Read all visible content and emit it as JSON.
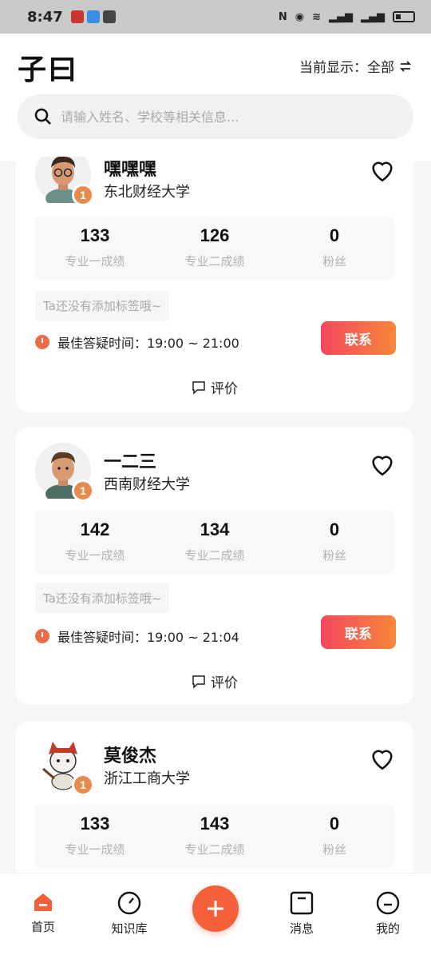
{
  "statusbar": {
    "time": "8:47"
  },
  "header": {
    "title": "子曰",
    "display_label": "当前显示：全部",
    "search_placeholder": "请输入姓名、学校等相关信息..."
  },
  "cards": [
    {
      "name": "嘿嘿嘿",
      "school": "东北财经大学",
      "rank": "1",
      "stats": [
        {
          "value": "133",
          "label": "专业一成绩"
        },
        {
          "value": "126",
          "label": "专业二成绩"
        },
        {
          "value": "0",
          "label": "粉丝"
        }
      ],
      "tag_text": "Ta还没有添加标签哦~",
      "best_time": "最佳答疑时间：19:00 ~ 21:00",
      "contact_label": "联系",
      "review_label": "评价"
    },
    {
      "name": "一二三",
      "school": "西南财经大学",
      "rank": "1",
      "stats": [
        {
          "value": "142",
          "label": "专业一成绩"
        },
        {
          "value": "134",
          "label": "专业二成绩"
        },
        {
          "value": "0",
          "label": "粉丝"
        }
      ],
      "tag_text": "Ta还没有添加标签哦~",
      "best_time": "最佳答疑时间：19:00 ~ 21:04",
      "contact_label": "联系",
      "review_label": "评价"
    },
    {
      "name": "莫俊杰",
      "school": "浙江工商大学",
      "rank": "1",
      "stats": [
        {
          "value": "133",
          "label": "专业一成绩"
        },
        {
          "value": "143",
          "label": "专业二成绩"
        },
        {
          "value": "0",
          "label": "粉丝"
        }
      ]
    }
  ],
  "tabbar": {
    "items": [
      {
        "label": "首页",
        "icon": "home-icon",
        "active": true
      },
      {
        "label": "知识库",
        "icon": "compass-icon"
      },
      {
        "label": "",
        "icon": "plus-icon"
      },
      {
        "label": "消息",
        "icon": "message-box-icon"
      },
      {
        "label": "我的",
        "icon": "profile-icon"
      }
    ]
  },
  "colors": {
    "accent": "#f4603a",
    "button_gradient_start": "#f5475f",
    "button_gradient_end": "#f7863a",
    "badge": "#e88a4c"
  }
}
